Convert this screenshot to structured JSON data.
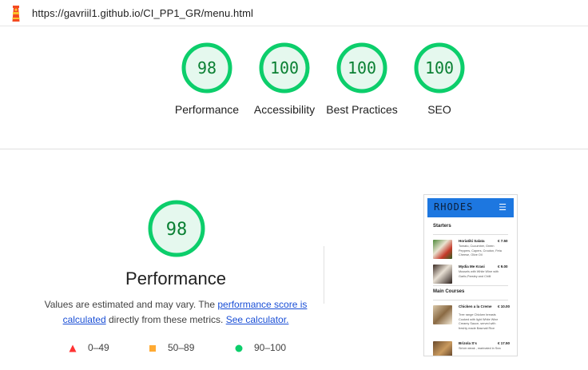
{
  "browser": {
    "url": "https://gavriil1.github.io/CI_PP1_GR/menu.html"
  },
  "gauges": [
    {
      "score": "98",
      "label": "Performance"
    },
    {
      "score": "100",
      "label": "Accessibility"
    },
    {
      "score": "100",
      "label": "Best Practices"
    },
    {
      "score": "100",
      "label": "SEO"
    }
  ],
  "main_score": {
    "score": "98",
    "title": "Performance"
  },
  "description": {
    "text1": "Values are estimated and may vary. The ",
    "link1": "performance score is calculated",
    "text2": " directly from these metrics. ",
    "link2": "See calculator."
  },
  "legend": [
    {
      "range": "0–49",
      "color": "#ff3333"
    },
    {
      "range": "50–89",
      "color": "#ffaa33"
    },
    {
      "range": "90–100",
      "color": "#0cce6b"
    }
  ],
  "colors": {
    "pass": "#0cce6b",
    "pass_bg": "#e5f8ee",
    "pass_text": "#0a8033",
    "link": "#1a4fd6"
  },
  "preview": {
    "brand": "RHODES",
    "menu_icon": "hamburger-icon",
    "sections": [
      {
        "title": "Starters"
      },
      {
        "title": "Main Courses"
      }
    ],
    "items": [
      {
        "name": "Horiatiki Salata",
        "price": "€ 7.50",
        "desc": "Tomato, Cucumber, Green Peppers, Capers, Crouton, Feta Cheese, Olive Oil"
      },
      {
        "name": "Mydia Me Krasi",
        "price": "€ 9.00",
        "desc": "Mussels with White Wine with Garlic,Parsley and Chilli"
      },
      {
        "name": "Chicken a la Creme",
        "price": "€ 10.00",
        "desc": "Tree range Chicken breasts Cooked with light White Wine Creamy Sauce, served with freshly made Basmati Rice"
      },
      {
        "name": "Brizola S's",
        "price": "€ 17.50",
        "desc": "Sirloin steak , marinated in Sea"
      }
    ]
  }
}
